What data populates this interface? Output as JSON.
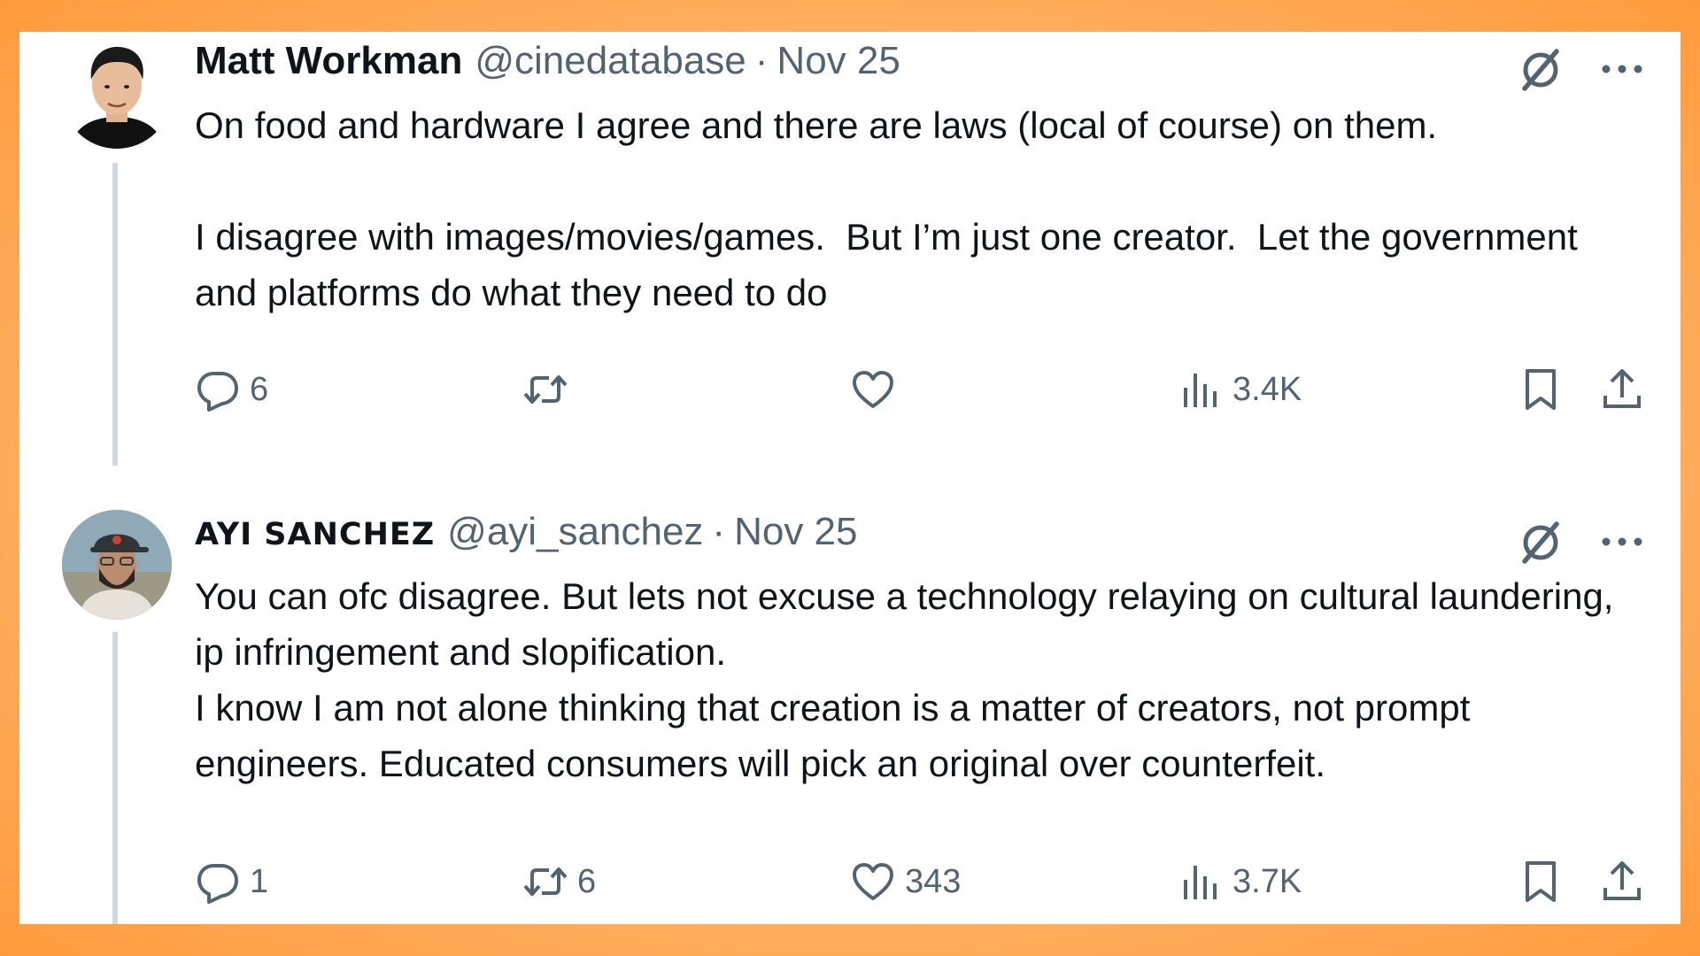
{
  "tweets": [
    {
      "author": "Matt Workman",
      "handle": "@cinedatabase",
      "separator": "·",
      "date": "Nov 25",
      "paragraphs": [
        "On food and hardware I agree and there are laws (local of course) on them.",
        "",
        "I disagree with images/movies/games.  But I’m just one creator.  Let the government and platforms do what they need to do"
      ],
      "stats": {
        "replies": "6",
        "reposts": "",
        "likes": "",
        "views": "3.4K"
      }
    },
    {
      "author": "AYI SANCHEZ",
      "handle": "@ayi_sanchez",
      "separator": "·",
      "date": "Nov 25",
      "paragraphs": [
        "You can ofc disagree. But lets not excuse a technology relaying on cultural laundering, ip infringement and slopification.",
        "I know I am not alone thinking that creation is a matter of creators, not prompt engineers. Educated consumers will pick an original over counterfeit."
      ],
      "stats": {
        "replies": "1",
        "reposts": "6",
        "likes": "343",
        "views": "3.7K"
      }
    }
  ],
  "icons": {
    "reply": "reply-icon",
    "repost": "repost-icon",
    "like": "heart-icon",
    "views": "views-icon",
    "bookmark": "bookmark-icon",
    "share": "share-icon",
    "grok": "grok-icon",
    "more": "more-icon"
  },
  "colors": {
    "text": "#0f1419",
    "secondary": "#536471",
    "thread_line": "#cfd9de",
    "frame_outer": "#ff9a3c",
    "frame_inner": "#ffe3c4"
  }
}
